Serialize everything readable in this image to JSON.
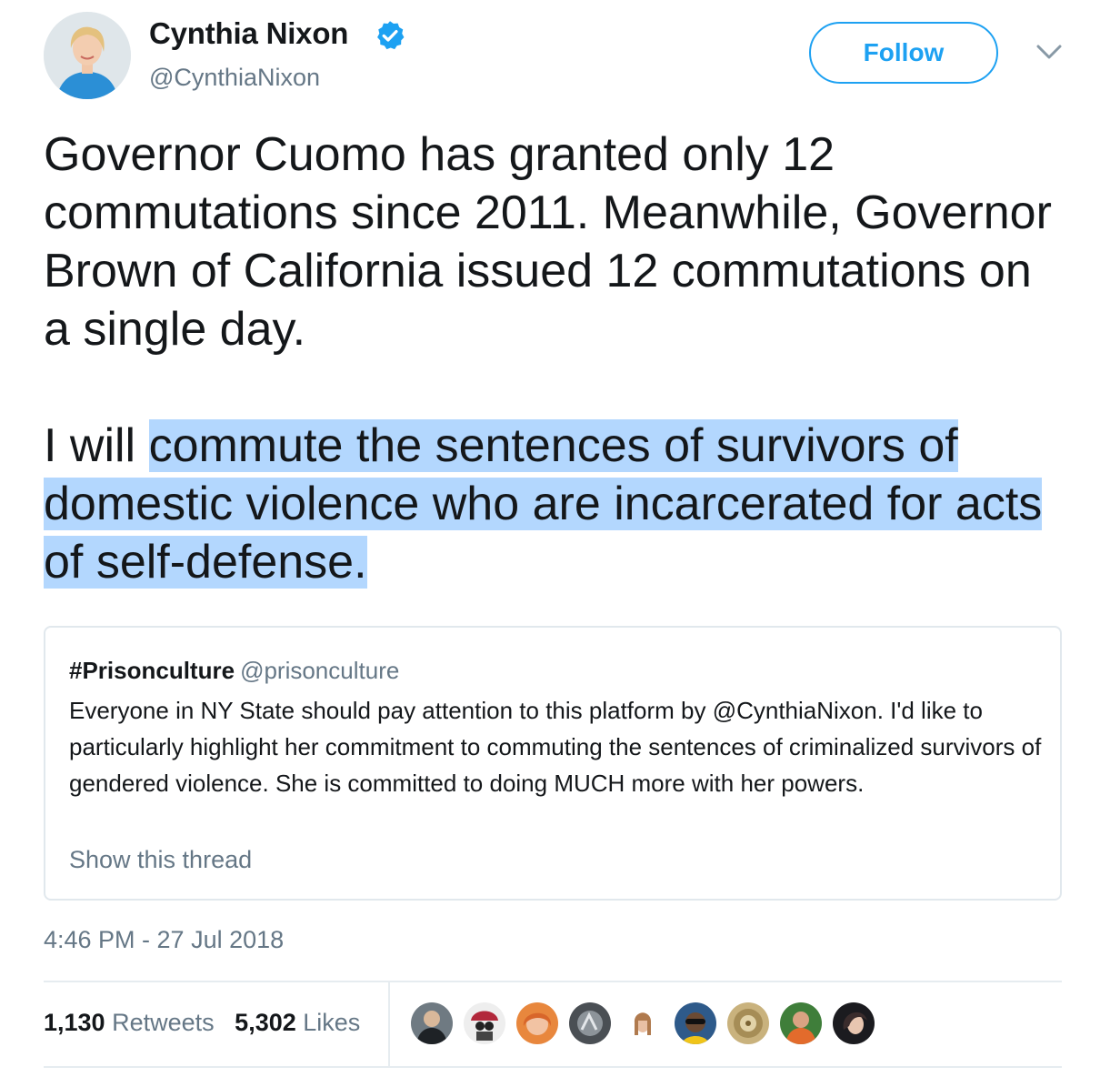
{
  "author": {
    "name": "Cynthia Nixon",
    "handle": "@CynthiaNixon",
    "verified_icon": "verified-badge-icon",
    "avatar_icon": "user-avatar"
  },
  "follow_label": "Follow",
  "tweet": {
    "para1": "Governor Cuomo has granted only 12 commutations since 2011. Meanwhile, Governor Brown of California issued 12 commutations on a single day.",
    "para2_prefix": "I will ",
    "para2_highlight": "commute the sentences of survivors of domestic violence who are incarcerated for acts of self-defense."
  },
  "quoted": {
    "name": "#Prisonculture",
    "handle": "@prisonculture",
    "text": "Everyone in NY State should pay attention to this platform by @CynthiaNixon. I'd like to particularly highlight her commitment to commuting the sentences of criminalized survivors of gendered violence. She is committed to doing MUCH more with her powers.",
    "show_thread": "Show this thread"
  },
  "timestamp": "4:46 PM - 27 Jul 2018",
  "stats": {
    "retweets_count": "1,130",
    "retweets_label": "Retweets",
    "likes_count": "5,302",
    "likes_label": "Likes"
  },
  "colors": {
    "accent": "#1da1f2",
    "highlight": "#b3d7fe",
    "secondary_text": "#657786"
  }
}
